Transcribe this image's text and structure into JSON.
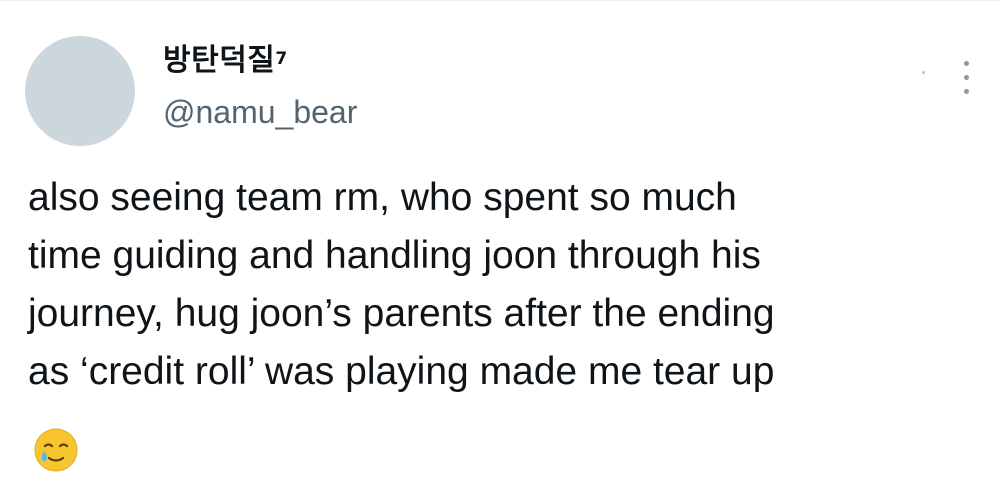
{
  "tweet": {
    "display_name": "방탄덕질",
    "display_name_suffix": "7",
    "handle": "@namu_bear",
    "text_lines": [
      "also seeing team rm, who spent so much",
      "time guiding and handling joon through his",
      "journey, hug joon’s parents after the ending",
      "as ‘credit roll’ was playing made me tear up"
    ],
    "emoji": "smiling-face-with-tear-icon"
  },
  "colors": {
    "text": "#0f1419",
    "secondary_text": "#536471",
    "avatar_placeholder": "#ccd6dd",
    "emoji_face": "#f7c62f",
    "emoji_tear": "#5db4e8"
  }
}
